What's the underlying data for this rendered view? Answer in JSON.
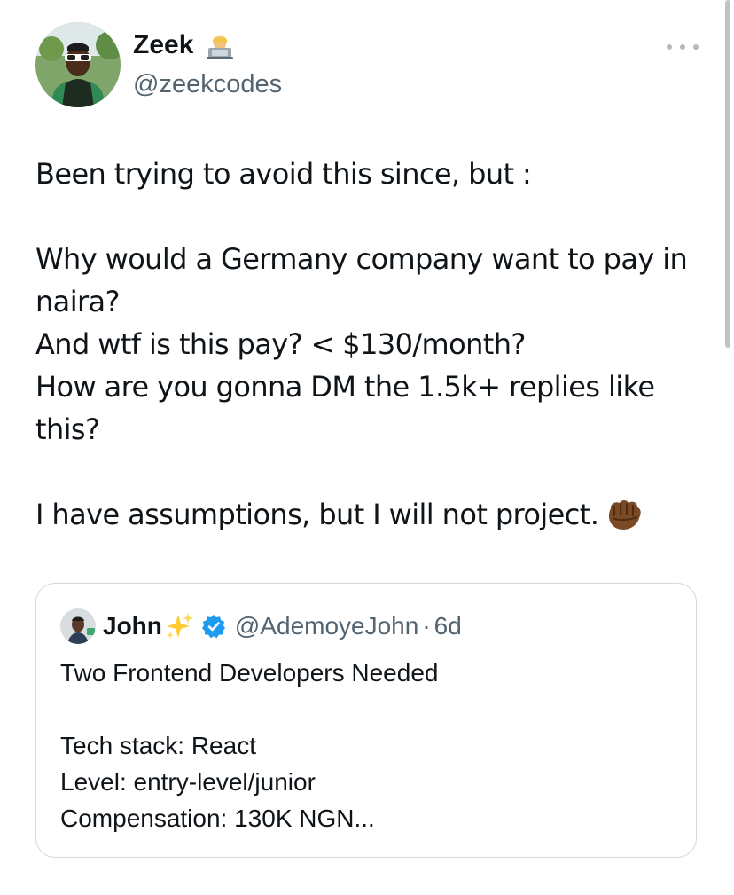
{
  "author": {
    "display_name": "Zeek",
    "name_emoji": "technologist-emoji",
    "handle": "@zeekcodes",
    "avatar_icon": "user-avatar"
  },
  "more_icon": "more-options-icon",
  "tweet": {
    "lines": [
      "Been trying to avoid this since, but :",
      "",
      "Why would a Germany company want to pay in naira?",
      "And wtf is this pay? < $130/month?",
      "How are you gonna DM the 1.5k+ replies like this?",
      "",
      "I have assumptions, but I will not project."
    ],
    "end_emoji": "fist-emoji"
  },
  "quote": {
    "display_name": "John",
    "name_emoji": "sparkles-emoji",
    "verified_icon": "verified-badge-icon",
    "handle": "@AdemoyeJohn",
    "separator": "·",
    "time": "6d",
    "lines": [
      "Two Frontend Developers Needed",
      "",
      "Tech stack: React",
      "Level: entry-level/junior",
      "Compensation: 130K NGN..."
    ]
  },
  "colors": {
    "text": "#0f1419",
    "secondary": "#536471",
    "border": "#cfd9de",
    "verified": "#1d9bf0"
  }
}
